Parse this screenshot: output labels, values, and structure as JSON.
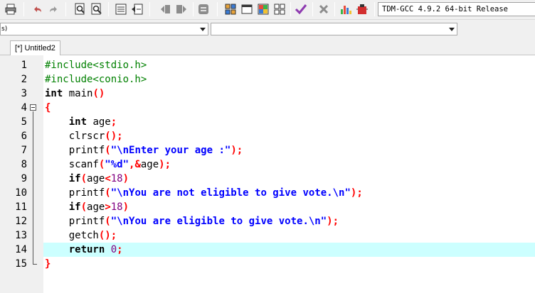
{
  "toolbar": {
    "buttons": [
      {
        "name": "print-icon"
      },
      {
        "name": "undo-icon"
      },
      {
        "name": "redo-icon"
      },
      {
        "name": "find-icon"
      },
      {
        "name": "replace-icon"
      },
      {
        "name": "indent-icon"
      },
      {
        "name": "goto-line-icon"
      },
      {
        "name": "toggle-bookmark-icon"
      },
      {
        "name": "goto-bookmark-icon"
      },
      {
        "name": "comment-icon"
      },
      {
        "name": "compile-icon"
      },
      {
        "name": "run-icon"
      },
      {
        "name": "compile-run-icon"
      },
      {
        "name": "rebuild-icon"
      },
      {
        "name": "syntax-check-icon"
      },
      {
        "name": "stop-icon"
      },
      {
        "name": "chart-icon"
      },
      {
        "name": "debug-icon"
      }
    ],
    "compiler": "TDM-GCC 4.9.2 64-bit Release"
  },
  "combos": {
    "left": "s)",
    "right": ""
  },
  "tabs": [
    {
      "label": "[*] Untitled2"
    }
  ],
  "editor": {
    "current_line": 14,
    "lines": [
      {
        "n": "1",
        "tokens": [
          {
            "t": "#include<stdio.h>",
            "c": "pp"
          }
        ]
      },
      {
        "n": "2",
        "tokens": [
          {
            "t": "#include<conio.h>",
            "c": "pp"
          }
        ]
      },
      {
        "n": "3",
        "tokens": [
          {
            "t": "int",
            "c": "kw"
          },
          {
            "t": " main",
            "c": "id"
          },
          {
            "t": "()",
            "c": "sym"
          }
        ]
      },
      {
        "n": "4",
        "tokens": [
          {
            "t": "{",
            "c": "sym"
          }
        ]
      },
      {
        "n": "5",
        "tokens": [
          {
            "t": "    ",
            "c": "id"
          },
          {
            "t": "int",
            "c": "kw"
          },
          {
            "t": " age",
            "c": "id"
          },
          {
            "t": ";",
            "c": "sym"
          }
        ]
      },
      {
        "n": "6",
        "tokens": [
          {
            "t": "    clrscr",
            "c": "id"
          },
          {
            "t": "();",
            "c": "sym"
          }
        ]
      },
      {
        "n": "7",
        "tokens": [
          {
            "t": "    printf",
            "c": "id"
          },
          {
            "t": "(",
            "c": "sym"
          },
          {
            "t": "\"\\nEnter your age :\"",
            "c": "str"
          },
          {
            "t": ");",
            "c": "sym"
          }
        ]
      },
      {
        "n": "8",
        "tokens": [
          {
            "t": "    scanf",
            "c": "id"
          },
          {
            "t": "(",
            "c": "sym"
          },
          {
            "t": "\"%d\"",
            "c": "str"
          },
          {
            "t": ",&",
            "c": "sym"
          },
          {
            "t": "age",
            "c": "id"
          },
          {
            "t": ");",
            "c": "sym"
          }
        ]
      },
      {
        "n": "9",
        "tokens": [
          {
            "t": "    ",
            "c": "id"
          },
          {
            "t": "if",
            "c": "kw"
          },
          {
            "t": "(",
            "c": "sym"
          },
          {
            "t": "age",
            "c": "id"
          },
          {
            "t": "<",
            "c": "sym"
          },
          {
            "t": "18",
            "c": "num"
          },
          {
            "t": ")",
            "c": "sym"
          }
        ]
      },
      {
        "n": "10",
        "tokens": [
          {
            "t": "    printf",
            "c": "id"
          },
          {
            "t": "(",
            "c": "sym"
          },
          {
            "t": "\"\\nYou are not eligible to give vote.\\n\"",
            "c": "str"
          },
          {
            "t": ");",
            "c": "sym"
          }
        ]
      },
      {
        "n": "11",
        "tokens": [
          {
            "t": "    ",
            "c": "id"
          },
          {
            "t": "if",
            "c": "kw"
          },
          {
            "t": "(",
            "c": "sym"
          },
          {
            "t": "age",
            "c": "id"
          },
          {
            "t": ">",
            "c": "sym"
          },
          {
            "t": "18",
            "c": "num"
          },
          {
            "t": ")",
            "c": "sym"
          }
        ]
      },
      {
        "n": "12",
        "tokens": [
          {
            "t": "    printf",
            "c": "id"
          },
          {
            "t": "(",
            "c": "sym"
          },
          {
            "t": "\"\\nYou are eligible to give vote.\\n\"",
            "c": "str"
          },
          {
            "t": ");",
            "c": "sym"
          }
        ]
      },
      {
        "n": "13",
        "tokens": [
          {
            "t": "    getch",
            "c": "id"
          },
          {
            "t": "();",
            "c": "sym"
          }
        ]
      },
      {
        "n": "14",
        "tokens": [
          {
            "t": "    ",
            "c": "id"
          },
          {
            "t": "return",
            "c": "kw"
          },
          {
            "t": " ",
            "c": "id"
          },
          {
            "t": "0",
            "c": "num"
          },
          {
            "t": ";",
            "c": "sym"
          }
        ]
      },
      {
        "n": "15",
        "tokens": [
          {
            "t": "}",
            "c": "sym"
          }
        ]
      }
    ]
  }
}
